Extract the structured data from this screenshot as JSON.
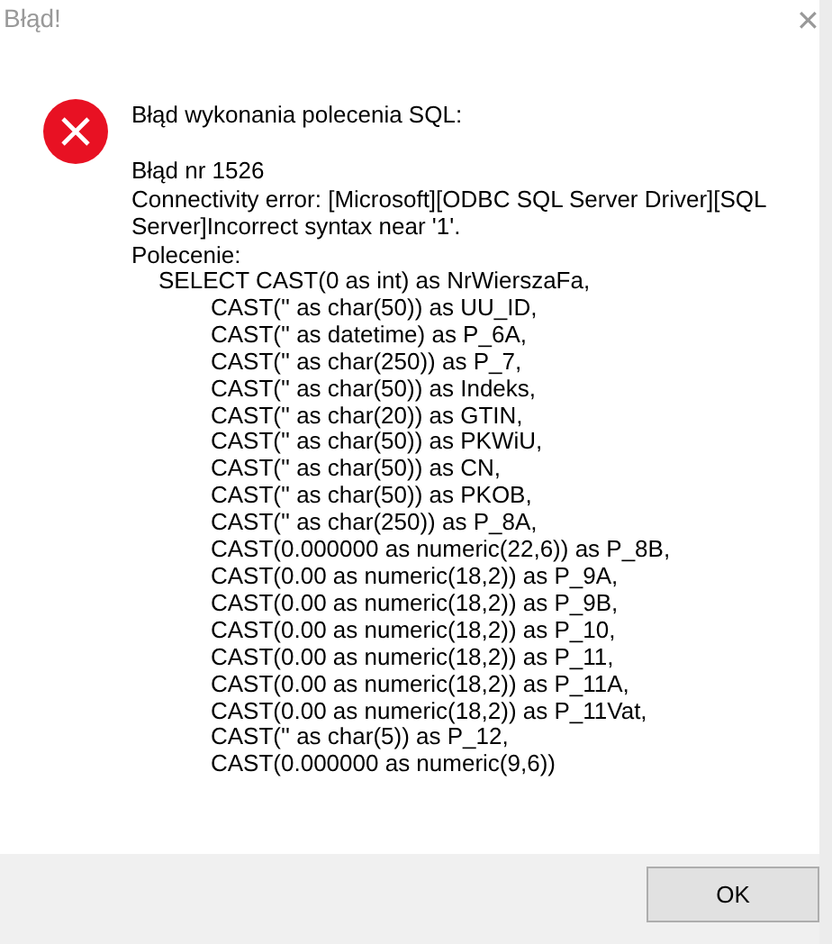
{
  "window": {
    "title": "Błąd!",
    "close": "✕"
  },
  "message": {
    "heading": "Błąd wykonania polecenia SQL:",
    "error_number": "Błąd nr 1526",
    "details": "Connectivity error: [Microsoft][ODBC SQL Server Driver][SQL Server]Incorrect syntax near '1'.",
    "command_label": "Polecenie:",
    "sql_lines": [
      {
        "kind": "first",
        "text": "SELECT CAST(0 as int) as NrWierszaFa,"
      },
      {
        "kind": "cont",
        "text": "CAST('' as char(50)) as UU_ID,"
      },
      {
        "kind": "cont",
        "text": "CAST('' as datetime) as P_6A,"
      },
      {
        "kind": "cont",
        "text": "CAST('' as char(250)) as P_7,"
      },
      {
        "kind": "cont",
        "text": "CAST('' as char(50)) as Indeks,"
      },
      {
        "kind": "cont",
        "text": "CAST('' as char(20)) as GTIN,"
      },
      {
        "kind": "cont",
        "text": "CAST('' as char(50)) as PKWiU,"
      },
      {
        "kind": "cont",
        "text": "CAST('' as char(50)) as CN,"
      },
      {
        "kind": "cont",
        "text": "CAST('' as char(50)) as PKOB,"
      },
      {
        "kind": "cont",
        "text": "CAST('' as char(250)) as P_8A,"
      },
      {
        "kind": "cont",
        "text": "CAST(0.000000 as numeric(22,6)) as P_8B,"
      },
      {
        "kind": "cont",
        "text": "CAST(0.00 as numeric(18,2)) as P_9A,"
      },
      {
        "kind": "cont",
        "text": "CAST(0.00 as numeric(18,2)) as P_9B,"
      },
      {
        "kind": "cont",
        "text": "CAST(0.00 as numeric(18,2)) as P_10,"
      },
      {
        "kind": "cont",
        "text": "CAST(0.00 as numeric(18,2)) as P_11,"
      },
      {
        "kind": "cont",
        "text": "CAST(0.00 as numeric(18,2)) as P_11A,"
      },
      {
        "kind": "cont",
        "text": "CAST(0.00 as numeric(18,2)) as P_11Vat,"
      },
      {
        "kind": "cont",
        "text": "CAST('' as char(5)) as P_12,"
      },
      {
        "kind": "cont",
        "text": "CAST(0.000000 as numeric(9,6))"
      }
    ]
  },
  "buttons": [
    "OK"
  ]
}
